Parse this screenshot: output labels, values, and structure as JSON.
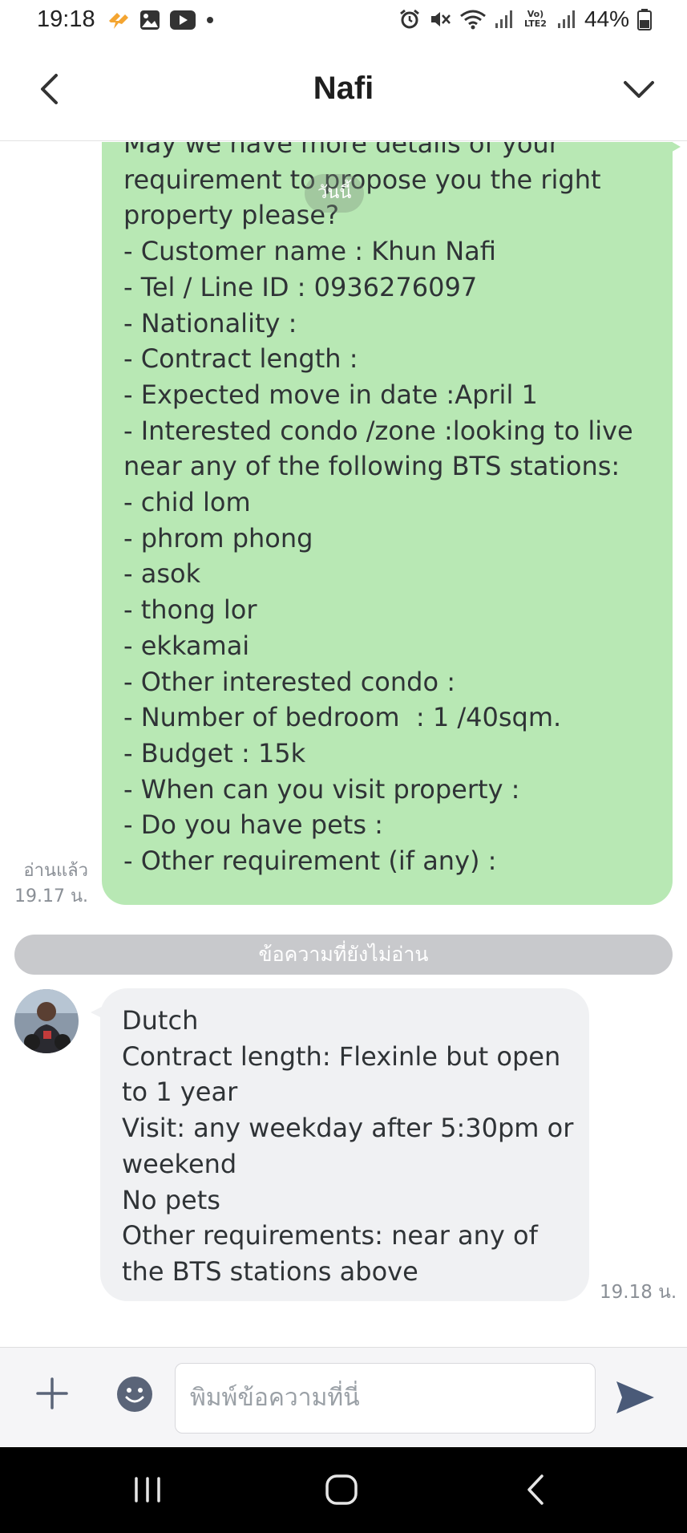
{
  "status_bar": {
    "time": "19:18",
    "battery": "44%",
    "left_icons": [
      "flash-app-icon",
      "gallery-icon",
      "youtube-icon",
      "dot-icon"
    ],
    "right_icons": [
      "alarm-icon",
      "mute-icon",
      "wifi-icon",
      "signal-icon",
      "volte-icon",
      "signal-icon",
      "battery-icon"
    ],
    "volte_label": "Vo) LTE2"
  },
  "header": {
    "title": "Nafi"
  },
  "chat": {
    "date_label": "วันนี้",
    "outgoing_message": "May we have more details of your requirement to propose you the right property please?\n- Customer name : Khun Nafi\n- Tel / Line ID : 0936276097\n- Nationality :\n- Contract length :\n- Expected move in date :April 1\n- Interested condo /zone :looking to live near any of the following BTS stations:\n- chid lom\n- phrom phong\n- asok\n- thong lor\n- ekkamai\n- Other interested condo :\n- Number of bedroom  : 1 /40sqm.\n- Budget : 15k\n- When can you visit property :\n- Do you have pets :\n- Other requirement (if any) :",
    "read_label": "อ่านแล้ว",
    "outgoing_time": "19.17 น.",
    "unread_divider": "ข้อความที่ยังไม่อ่าน",
    "incoming_message": "Dutch\nContract length: Flexinle but open to 1 year\nVisit: any weekday after 5:30pm or weekend\nNo pets\nOther requirements: near any of the BTS stations above",
    "incoming_time": "19.18 น."
  },
  "input_bar": {
    "placeholder": "พิมพ์ข้อความที่นี่"
  },
  "colors": {
    "outgoing_bubble": "#b8e8b4",
    "incoming_bubble": "#f0f1f3",
    "unread_divider": "#c8c9cc",
    "send_icon": "#4a5a78"
  }
}
